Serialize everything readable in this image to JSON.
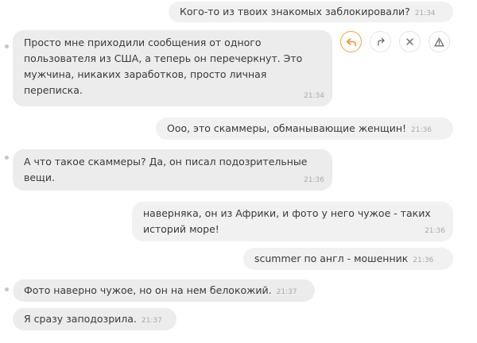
{
  "messages": [
    {
      "direction": "outgoing",
      "text": "Кого-то из твоих знакомых заблокировали?",
      "time": "21:34"
    },
    {
      "direction": "incoming",
      "text": "Просто мне приходили сообщения от одного пользователя из США, а теперь он перечеркнут. Это мужчина, никаких заработков, просто личная переписка.",
      "time": "21:34"
    },
    {
      "direction": "outgoing",
      "text": "Ооо, это скаммеры, обманывающие женщин!",
      "time": "21:36"
    },
    {
      "direction": "incoming",
      "text": "А что такое скаммеры? Да, он писал подозрительные вещи.",
      "time": "21:36"
    },
    {
      "direction": "outgoing",
      "text": "наверняка, он из Африки, и фото у него чужое - таких историй море!",
      "time": "21:36"
    },
    {
      "direction": "outgoing",
      "text": "scummer по англ - мошенник",
      "time": "21:36"
    },
    {
      "direction": "incoming",
      "text": "Фото наверно чужое, но он на нем белокожий.",
      "time": "21:37"
    },
    {
      "direction": "incoming",
      "text": "Я сразу заподозрила.",
      "time": "21:37"
    }
  ],
  "message_actions": [
    {
      "icon": "reply-icon",
      "color": "#e8942a"
    },
    {
      "icon": "forward-icon",
      "color": "#6a6a6a"
    },
    {
      "icon": "close-icon",
      "color": "#6a6a6a"
    },
    {
      "icon": "warning-icon",
      "color": "#6a6a6a"
    }
  ],
  "colors": {
    "bubble": "#ececec",
    "accent": "#f0a33c",
    "timestamp": "#a9a9a9"
  }
}
